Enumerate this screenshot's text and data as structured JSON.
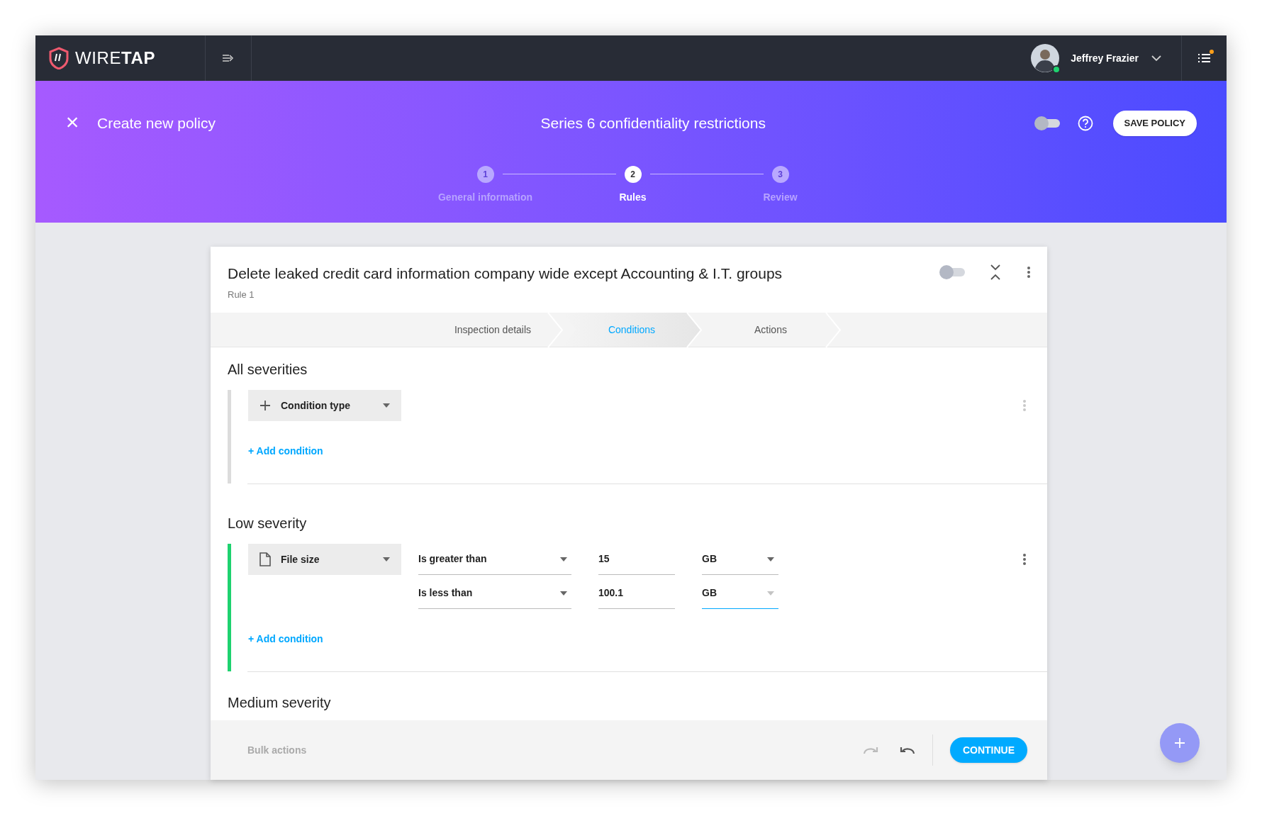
{
  "topbar": {
    "logo": "WIRE**TAP**",
    "user": {
      "name": "Jeffrey Frazier",
      "online": true
    },
    "notifications": true
  },
  "header": {
    "close_label": "×",
    "title": "Create new policy",
    "policy_name": "Series 6 confidentiality restrictions",
    "toggle": {
      "on": false
    },
    "save_button": "SAVE POLICY",
    "steps": [
      {
        "number": "1",
        "label": "General information",
        "selected": false
      },
      {
        "number": "2",
        "label": "Rules",
        "selected": true
      },
      {
        "number": "3",
        "label": "Review",
        "selected": false
      }
    ]
  },
  "rule": {
    "title": "Delete leaked credit card information company wide except Accounting & I.T. groups",
    "subtitle": "Rule 1",
    "toggle": {
      "on": false
    },
    "tabs": [
      {
        "label": "Inspection details",
        "selected": false
      },
      {
        "label": "Conditions",
        "selected": true
      },
      {
        "label": "Actions",
        "selected": false
      }
    ],
    "sections": [
      {
        "title": "All severities",
        "color": "#dcdcdc",
        "condition": {
          "kind": "add",
          "label": "Condition type"
        },
        "add_link": "+ Add condition"
      },
      {
        "title": "Low severity",
        "color": "#1ed26f",
        "condition": {
          "kind": "file",
          "label": "File size"
        },
        "rows": [
          {
            "operator": "Is greater than",
            "value": "15",
            "unit": "GB",
            "focused": false
          },
          {
            "operator": "Is less than",
            "value": "100.1",
            "unit": "GB",
            "focused": true
          }
        ],
        "add_link": "+ Add condition"
      },
      {
        "title": "Medium severity"
      }
    ],
    "footer": {
      "bulk_actions": "Bulk actions",
      "continue_button": "CONTINUE"
    }
  }
}
